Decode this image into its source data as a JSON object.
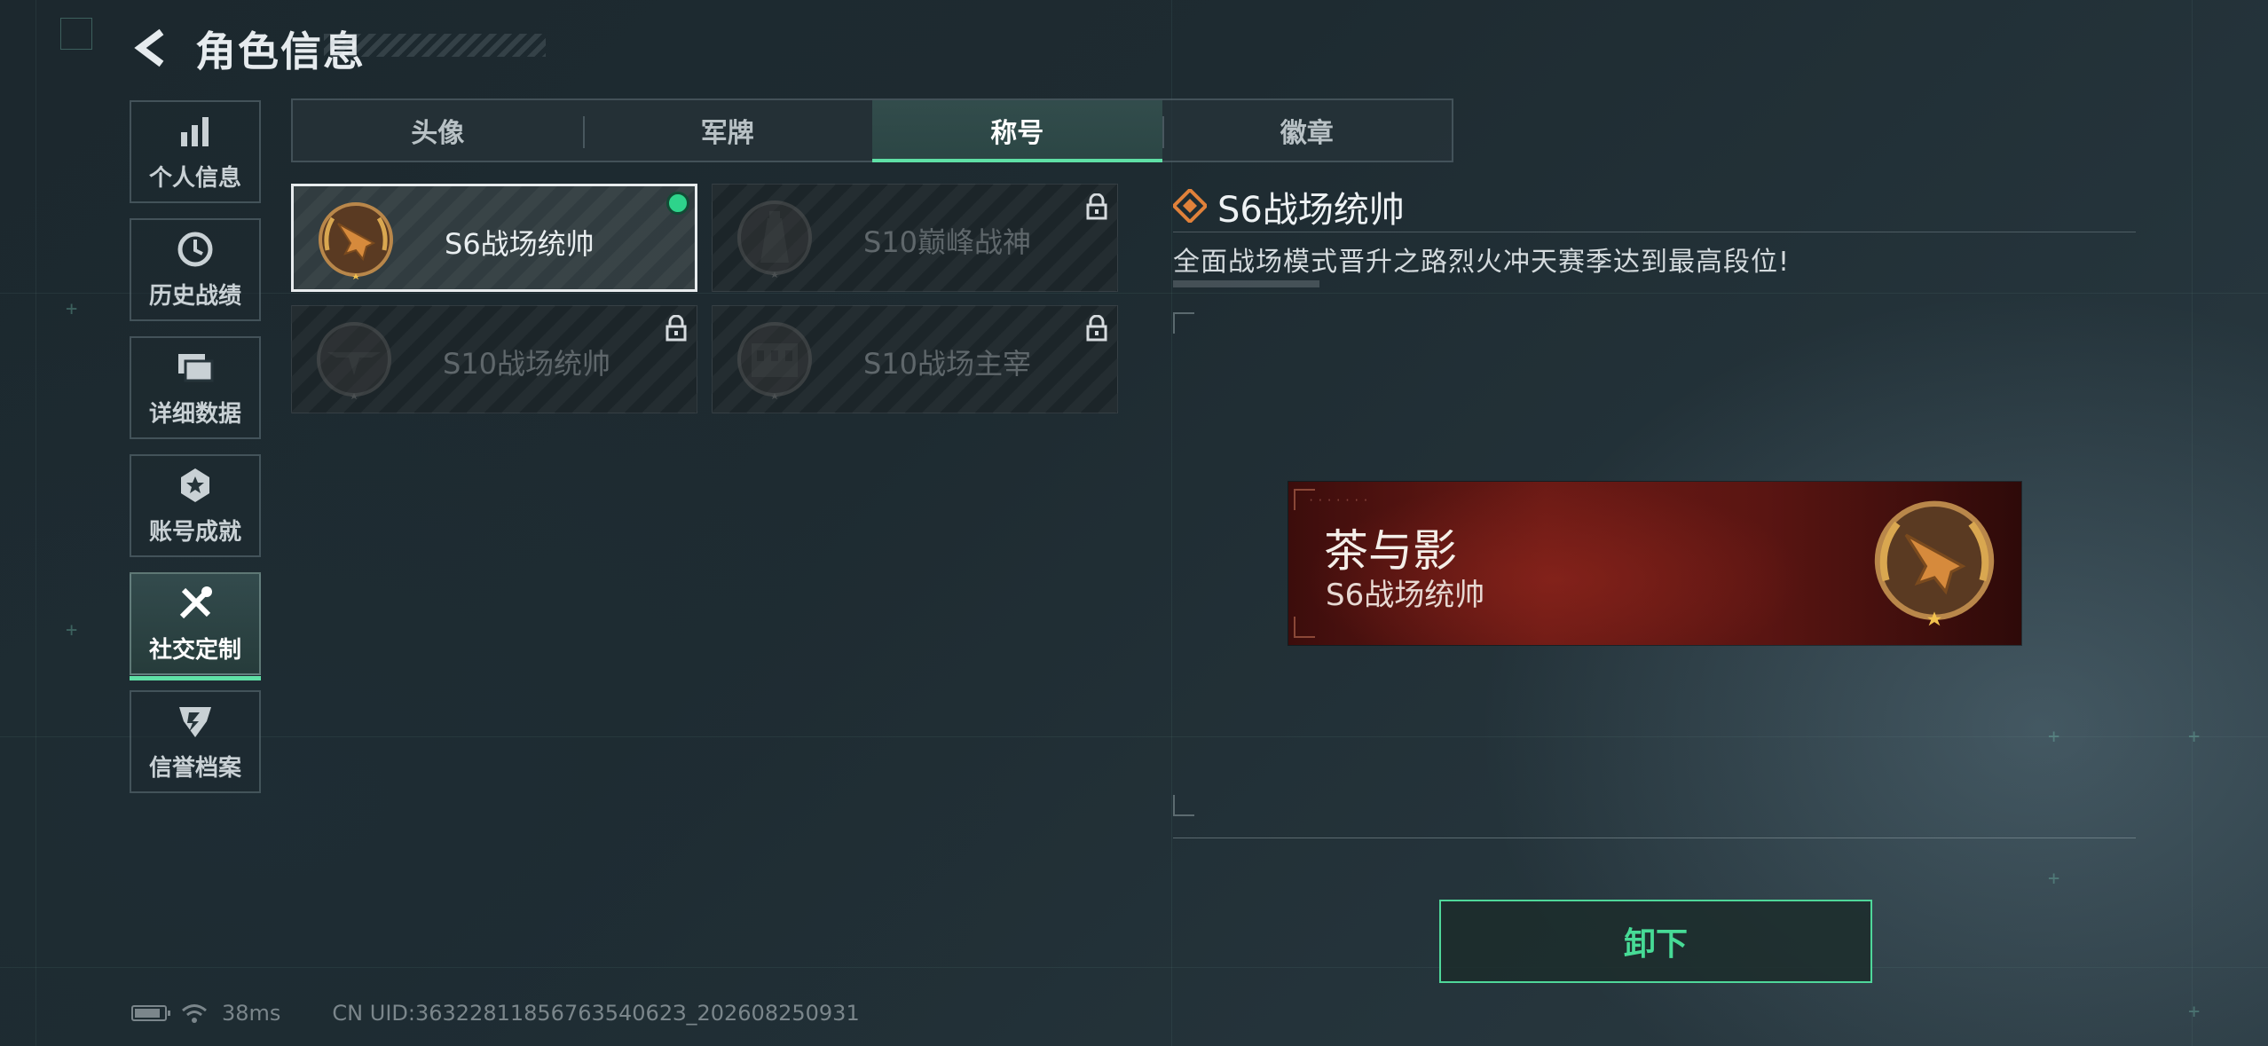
{
  "header": {
    "title": "角色信息",
    "back_icon": "back-arrow-icon"
  },
  "sidebar": {
    "items": [
      {
        "label": "个人信息",
        "icon": "bar-chart-icon",
        "active": false
      },
      {
        "label": "历史战绩",
        "icon": "clock-icon",
        "active": false
      },
      {
        "label": "详细数据",
        "icon": "folders-icon",
        "active": false
      },
      {
        "label": "账号成就",
        "icon": "medal-icon",
        "active": false
      },
      {
        "label": "社交定制",
        "icon": "wrench-screwdriver-icon",
        "active": true
      },
      {
        "label": "信誉档案",
        "icon": "shield-emblem-icon",
        "active": false
      }
    ]
  },
  "tabs": [
    {
      "label": "头像",
      "active": false
    },
    {
      "label": "军牌",
      "active": false
    },
    {
      "label": "称号",
      "active": true
    },
    {
      "label": "徽章",
      "active": false
    }
  ],
  "titles": [
    {
      "name": "S6战场统帅",
      "emblem": "fighter-jet-laurel-icon",
      "selected": true,
      "equipped": true,
      "locked": false
    },
    {
      "name": "S10巅峰战神",
      "emblem": "tower-laurel-icon",
      "selected": false,
      "equipped": false,
      "locked": true
    },
    {
      "name": "S10战场统帅",
      "emblem": "aircraft-laurel-icon",
      "selected": false,
      "equipped": false,
      "locked": true
    },
    {
      "name": "S10战场主宰",
      "emblem": "colosseum-laurel-icon",
      "selected": false,
      "equipped": false,
      "locked": true
    }
  ],
  "detail": {
    "title": "S6战场统帅",
    "title_icon": "diamond-rank-icon",
    "description": "全面战场模式晋升之路烈火冲天赛季达到最高段位!"
  },
  "nameplate": {
    "player_name": "茶与影",
    "title": "S6战场统帅",
    "emblem": "fighter-jet-laurel-icon"
  },
  "actions": {
    "unequip_label": "卸下"
  },
  "status_bar": {
    "battery_icon": "battery-icon",
    "wifi_icon": "wifi-icon",
    "ping": "38ms",
    "uid": "CN UID:3632281185676354062З_202608250931"
  },
  "colors": {
    "accent": "#5fe0a6",
    "equipped_dot": "#2ed38b",
    "banner_red": "#6b1a15",
    "background": "#1e2b31"
  }
}
